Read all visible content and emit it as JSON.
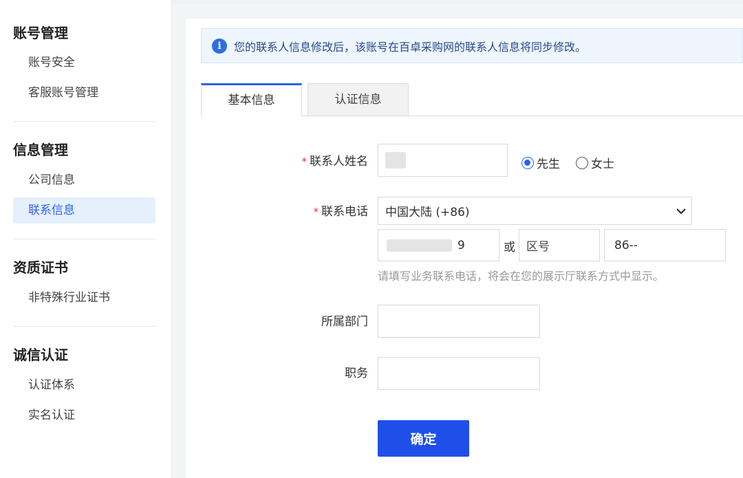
{
  "sidebar": {
    "groups": [
      {
        "title": "账号管理",
        "items": [
          "账号安全",
          "客服账号管理"
        ]
      },
      {
        "title": "信息管理",
        "items": [
          "公司信息",
          "联系信息"
        ]
      },
      {
        "title": "资质证书",
        "items": [
          "非特殊行业证书"
        ]
      },
      {
        "title": "诚信认证",
        "items": [
          "认证体系",
          "实名认证"
        ]
      }
    ],
    "active_item": "联系信息"
  },
  "notice": {
    "icon": "info-icon",
    "text": "您的联系人信息修改后，该账号在百卓采购网的联系人信息将同步修改。"
  },
  "tabs": [
    {
      "label": "基本信息",
      "active": true
    },
    {
      "label": "认证信息",
      "active": false
    }
  ],
  "form": {
    "required_mark": "*",
    "name_label": "联系人姓名",
    "gender_options": [
      {
        "label": "先生",
        "checked": true
      },
      {
        "label": "女士",
        "checked": false
      }
    ],
    "phone_label": "联系电话",
    "country_value": "中国大陆 (+86)",
    "phone_partial": "9",
    "or_text": "或",
    "area_placeholder": "区号",
    "landline_value": "86--",
    "phone_hint": "请填写业务联系电话，将会在您的展示厅联系方式中显示。",
    "dept_label": "所属部门",
    "position_label": "职务",
    "submit_label": "确定"
  },
  "colors": {
    "accent": "#2b62e8",
    "button": "#1f4fe8",
    "required": "#e0343a"
  }
}
